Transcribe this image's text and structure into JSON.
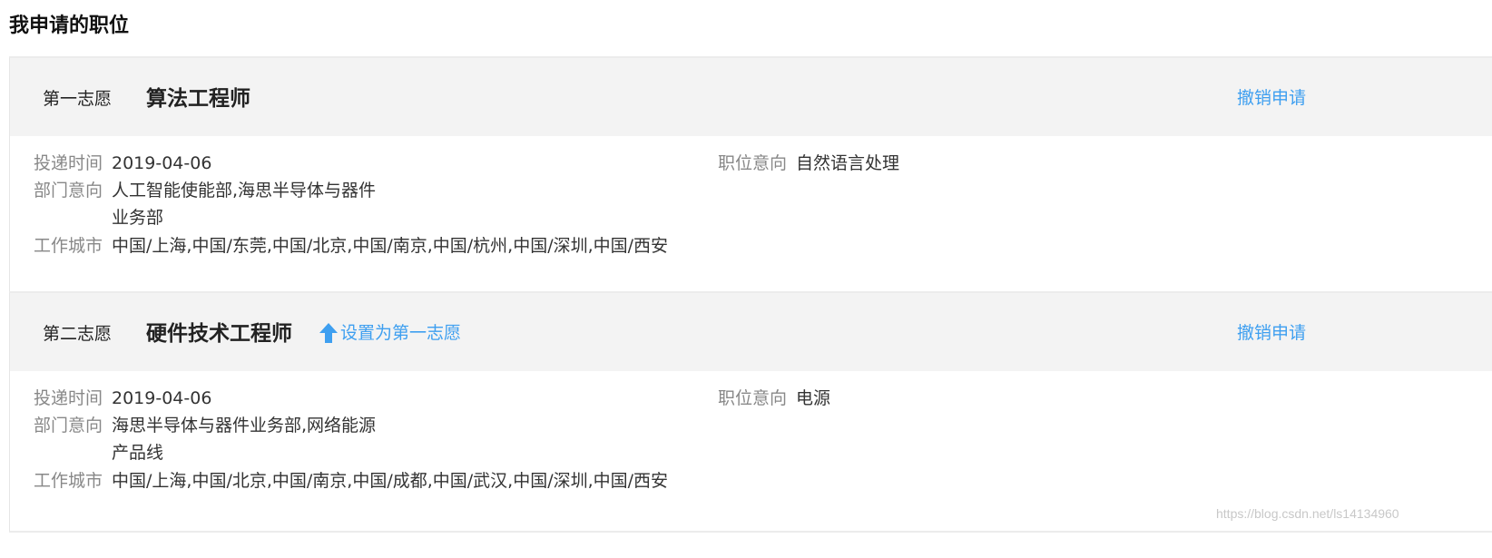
{
  "page": {
    "title": "我申请的职位"
  },
  "applications": [
    {
      "preference": "第一志愿",
      "job_title": "算法工程师",
      "revoke_label": "撤销申请",
      "submit_time_label": "投递时间",
      "submit_time": "2019-04-06",
      "department_label": "部门意向",
      "department_line1": "人工智能使能部,海思半导体与器件",
      "department_line2": "业务部",
      "city_label": "工作城市",
      "cities": "中国/上海,中国/东莞,中国/北京,中国/南京,中国/杭州,中国/深圳,中国/西安",
      "position_intent_label": "职位意向",
      "position_intent": "自然语言处理"
    },
    {
      "preference": "第二志愿",
      "job_title": "硬件技术工程师",
      "set_first_label": "设置为第一志愿",
      "set_first_icon": "arrow-up-icon",
      "revoke_label": "撤销申请",
      "submit_time_label": "投递时间",
      "submit_time": "2019-04-06",
      "department_label": "部门意向",
      "department_line1": "海思半导体与器件业务部,网络能源",
      "department_line2": "产品线",
      "city_label": "工作城市",
      "cities": "中国/上海,中国/北京,中国/南京,中国/成都,中国/武汉,中国/深圳,中国/西安",
      "position_intent_label": "职位意向",
      "position_intent": "电源"
    }
  ],
  "watermark": "https://blog.csdn.net/ls14134960",
  "colors": {
    "link": "#3e9ff0",
    "header_bg": "#f3f3f3",
    "label": "#888888",
    "text": "#333333"
  }
}
